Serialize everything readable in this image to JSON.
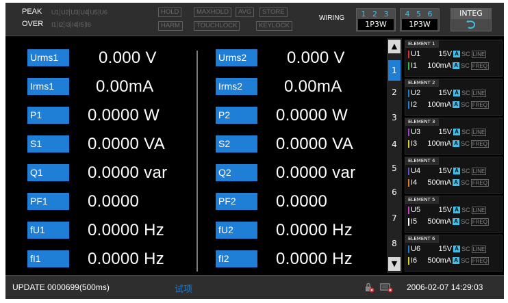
{
  "topbar": {
    "peak_label": "PEAK",
    "over_label": "OVER",
    "peak_channels": [
      "U1",
      "U2",
      "U3",
      "U4",
      "U5",
      "U6"
    ],
    "over_channels": [
      "I1",
      "I2",
      "I3",
      "I4",
      "I5",
      "I6"
    ],
    "hold": "HOLD",
    "maxhold": "MAXHOLD",
    "avg": "AVG",
    "store": "STORE",
    "harm": "HARM",
    "touchlock": "TOUCHLOCK",
    "keylock": "KEYLOCK",
    "wiring_label": "WIRING",
    "wiring_group1_nums": "1 2 3",
    "wiring_group1_mode": "1P3W",
    "wiring_group2_nums": "4 5 6",
    "wiring_group2_mode": "1P3W",
    "integ_label": "INTEG",
    "integ_icon": "undo-arrow-icon"
  },
  "left_column": [
    {
      "label": "Urms1",
      "value": "0.000 V"
    },
    {
      "label": "Irms1",
      "value": "0.00mA"
    },
    {
      "label": "P1",
      "value": "0.0000 W"
    },
    {
      "label": "S1",
      "value": "0.0000 VA"
    },
    {
      "label": "Q1",
      "value": "0.0000 var"
    },
    {
      "label": "PF1",
      "value": "0.0000"
    },
    {
      "label": "fU1",
      "value": "0.0000 Hz"
    },
    {
      "label": "fI1",
      "value": "0.0000 Hz"
    }
  ],
  "right_column": [
    {
      "label": "Urms2",
      "value": "0.000 V"
    },
    {
      "label": "Irms2",
      "value": "0.00mA"
    },
    {
      "label": "P2",
      "value": "0.0000 W"
    },
    {
      "label": "S2",
      "value": "0.0000 VA"
    },
    {
      "label": "Q2",
      "value": "0.0000 var"
    },
    {
      "label": "PF2",
      "value": "0.0000"
    },
    {
      "label": "fU2",
      "value": "0.0000 Hz"
    },
    {
      "label": "fI2",
      "value": "0.0000 Hz"
    }
  ],
  "pages": [
    "1",
    "2",
    "3",
    "4",
    "5",
    "6",
    "7",
    "8"
  ],
  "active_page": "1",
  "elements": [
    {
      "title": "ELEMENT 1",
      "u_label": "U1",
      "u_range": "15V",
      "i_label": "I1",
      "i_range": "100mA",
      "u_color": "#e03030",
      "i_color": "#30c030",
      "auto": "A",
      "sc": "SC",
      "u_tag": "LINE",
      "i_tag": "FREQ"
    },
    {
      "title": "ELEMENT 2",
      "u_label": "U2",
      "u_range": "15V",
      "i_label": "I2",
      "i_range": "100mA",
      "u_color": "#1f7ed6",
      "i_color": "#1f7ed6",
      "auto": "A",
      "sc": "SC",
      "u_tag": "LINE",
      "i_tag": "FREQ"
    },
    {
      "title": "ELEMENT 3",
      "u_label": "U3",
      "u_range": "15V",
      "i_label": "I3",
      "i_range": "100mA",
      "u_color": "#a040c0",
      "i_color": "#e0d020",
      "auto": "A",
      "sc": "SC",
      "u_tag": "LINE",
      "i_tag": "FREQ"
    },
    {
      "title": "ELEMENT 4",
      "u_label": "U4",
      "u_range": "15V",
      "i_label": "I4",
      "i_range": "500mA",
      "u_color": "#6050d0",
      "i_color": "#e08020",
      "auto": "A",
      "sc": "SC",
      "u_tag": "LINE",
      "i_tag": "FREQ"
    },
    {
      "title": "ELEMENT 5",
      "u_label": "U5",
      "u_range": "15V",
      "i_label": "I5",
      "i_range": "500mA",
      "u_color": "#d040c0",
      "i_color": "#ffffff",
      "auto": "A",
      "sc": "SC",
      "u_tag": "LINE",
      "i_tag": "FREQ"
    },
    {
      "title": "ELEMENT 6",
      "u_label": "U6",
      "u_range": "15V",
      "i_label": "I6",
      "i_range": "500mA",
      "u_color": "#1f7ed6",
      "i_color": "#e0d020",
      "auto": "A",
      "sc": "SC",
      "u_tag": "LINE",
      "i_tag": "FREQ"
    }
  ],
  "bottombar": {
    "update": "UPDATE 0000699(500ms)",
    "test_label": "试项",
    "datetime": "2006-02-07 14:29:03"
  },
  "colors": {
    "label_bg": "#1f7ed6",
    "accent_cyan": "#3ec0ea"
  }
}
